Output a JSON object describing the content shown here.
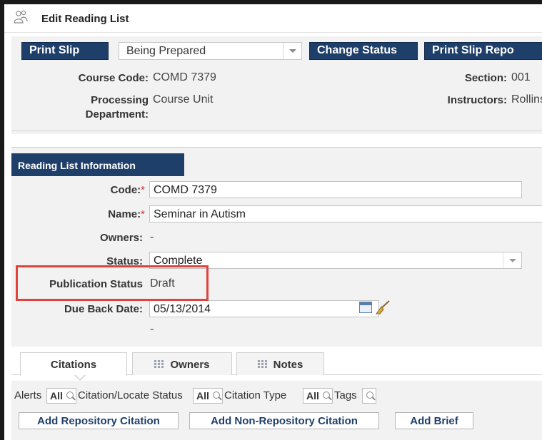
{
  "window": {
    "title": "Edit Reading List",
    "icon": "users-icon"
  },
  "toolbar": {
    "print_slip_label": "Print Slip",
    "status_value": "Being Prepared",
    "change_status_label": "Change Status",
    "print_slip_report_label": "Print Slip Repo"
  },
  "header": {
    "course_code_label": "Course Code:",
    "course_code_value": "COMD 7379",
    "section_label": "Section:",
    "section_value": "001",
    "processing_dept_label_1": "Processing",
    "processing_dept_label_2": "Department:",
    "processing_dept_value": "Course Unit",
    "instructors_label": "Instructors:",
    "instructors_value": "Rollins, P"
  },
  "reading_list": {
    "section_title": "Reading List Information",
    "code_label": "Code:",
    "code_value": "COMD 7379",
    "name_label": "Name:",
    "name_value": "Seminar in Autism",
    "owners_label": "Owners:",
    "owners_value": "-",
    "status_label": "Status:",
    "status_value": "Complete",
    "publication_status_label": "Publication Status",
    "publication_status_value": "Draft",
    "due_back_label": "Due Back Date:",
    "due_back_value": "05/13/2014",
    "extra_value": "-",
    "required_marker": "*",
    "highlight_color": "#e0423c"
  },
  "tabs": [
    {
      "label": "Citations",
      "active": true
    },
    {
      "label": "Owners",
      "active": false
    },
    {
      "label": "Notes",
      "active": false
    }
  ],
  "filters": {
    "alerts_label": "Alerts",
    "alerts_value": "All",
    "citation_locate_label": "Citation/Locate Status",
    "citation_locate_value": "All",
    "citation_type_label": "Citation Type",
    "citation_type_value": "All",
    "tags_label": "Tags"
  },
  "actions": {
    "add_repository_label": "Add Repository Citation",
    "add_non_repository_label": "Add Non-Repository Citation",
    "add_brief_label": "Add Brief"
  },
  "colors": {
    "primary": "#1f3f6b",
    "panel_bg": "#f2f2f2"
  }
}
